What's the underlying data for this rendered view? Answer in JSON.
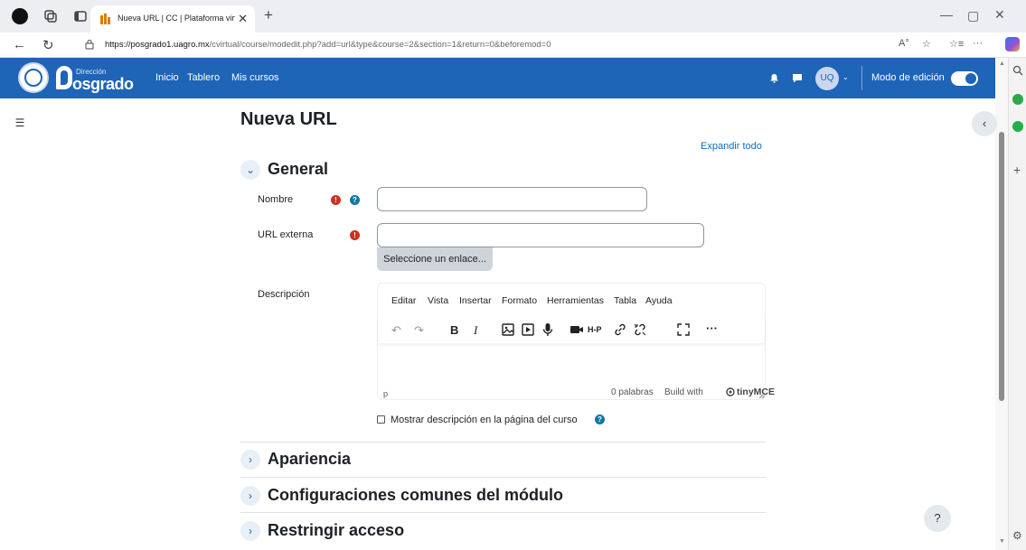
{
  "browser": {
    "tab_title": "Nueva URL | CC | Plataforma virtu",
    "tab_close": "✕",
    "new_tab": "+",
    "window": {
      "minimize": "—",
      "maximize": "▢",
      "close": "✕"
    },
    "nav": {
      "back": "←",
      "reload": "↻"
    },
    "url_host": "https://posgrado1.uagro.mx",
    "url_path": "/cvirtual/course/modedit.php?add=url&type&course=2&section=1&return=0&beforemod=0",
    "addr_icons": {
      "read_aloud": "A°",
      "favorite": "☆",
      "favorites_bar": "☆≡",
      "more": "···"
    },
    "sidebar": {
      "add": "+",
      "settings": "⚙"
    },
    "scroll": {
      "up": "▲",
      "down": "▼"
    }
  },
  "navbar": {
    "logo_small": "Dirección",
    "logo_big": "osgrado",
    "links": [
      "Inicio",
      "Tablero",
      "Mis cursos"
    ],
    "avatar": "UQ",
    "avatar_caret": "⌄",
    "edit_mode_label": "Modo de edición",
    "edit_mode_on": true
  },
  "drawers": {
    "left": "☰",
    "right": "‹"
  },
  "page": {
    "title": "Nueva URL",
    "expand_all": "Expandir todo",
    "sections": {
      "general": {
        "chevron": "⌄",
        "label": "General"
      },
      "apariencia": {
        "chevron": "›",
        "label": "Apariencia"
      },
      "configuraciones": {
        "chevron": "›",
        "label": "Configuraciones comunes del módulo"
      },
      "restringir": {
        "chevron": "›",
        "label": "Restringir acceso"
      }
    },
    "fields": {
      "nombre_label": "Nombre",
      "nombre_value": "",
      "url_label": "URL externa",
      "url_value": "",
      "choose_link": "Seleccione un enlace...",
      "descripcion_label": "Descripción"
    },
    "required_icon": "!",
    "help_icon": "?",
    "show_description_label": "Mostrar descripción en la página del curso",
    "show_description_checked": false
  },
  "editor": {
    "menu": [
      "Editar",
      "Vista",
      "Insertar",
      "Formato",
      "Herramientas",
      "Tabla",
      "Ayuda"
    ],
    "toolbar": {
      "undo": "↶",
      "redo": "↷",
      "bold": "B",
      "italic": "I",
      "h5p": "H-P",
      "more": "···"
    },
    "toolbar_icons": [
      "undo-icon",
      "redo-icon",
      "bold-icon",
      "italic-icon",
      "image-icon",
      "media-icon",
      "microphone-icon",
      "video-camera-icon",
      "h5p-icon",
      "link-icon",
      "unlink-icon",
      "fullscreen-icon",
      "more-icon"
    ],
    "path": "p",
    "word_count": "0 palabras",
    "build_with": "Build with",
    "tinymce": "tinyMCE"
  },
  "help_float": "?",
  "colors": {
    "navbar": "#1e64b7",
    "link": "#0f6cbf",
    "required": "#ca3120",
    "help": "#1177a3"
  }
}
